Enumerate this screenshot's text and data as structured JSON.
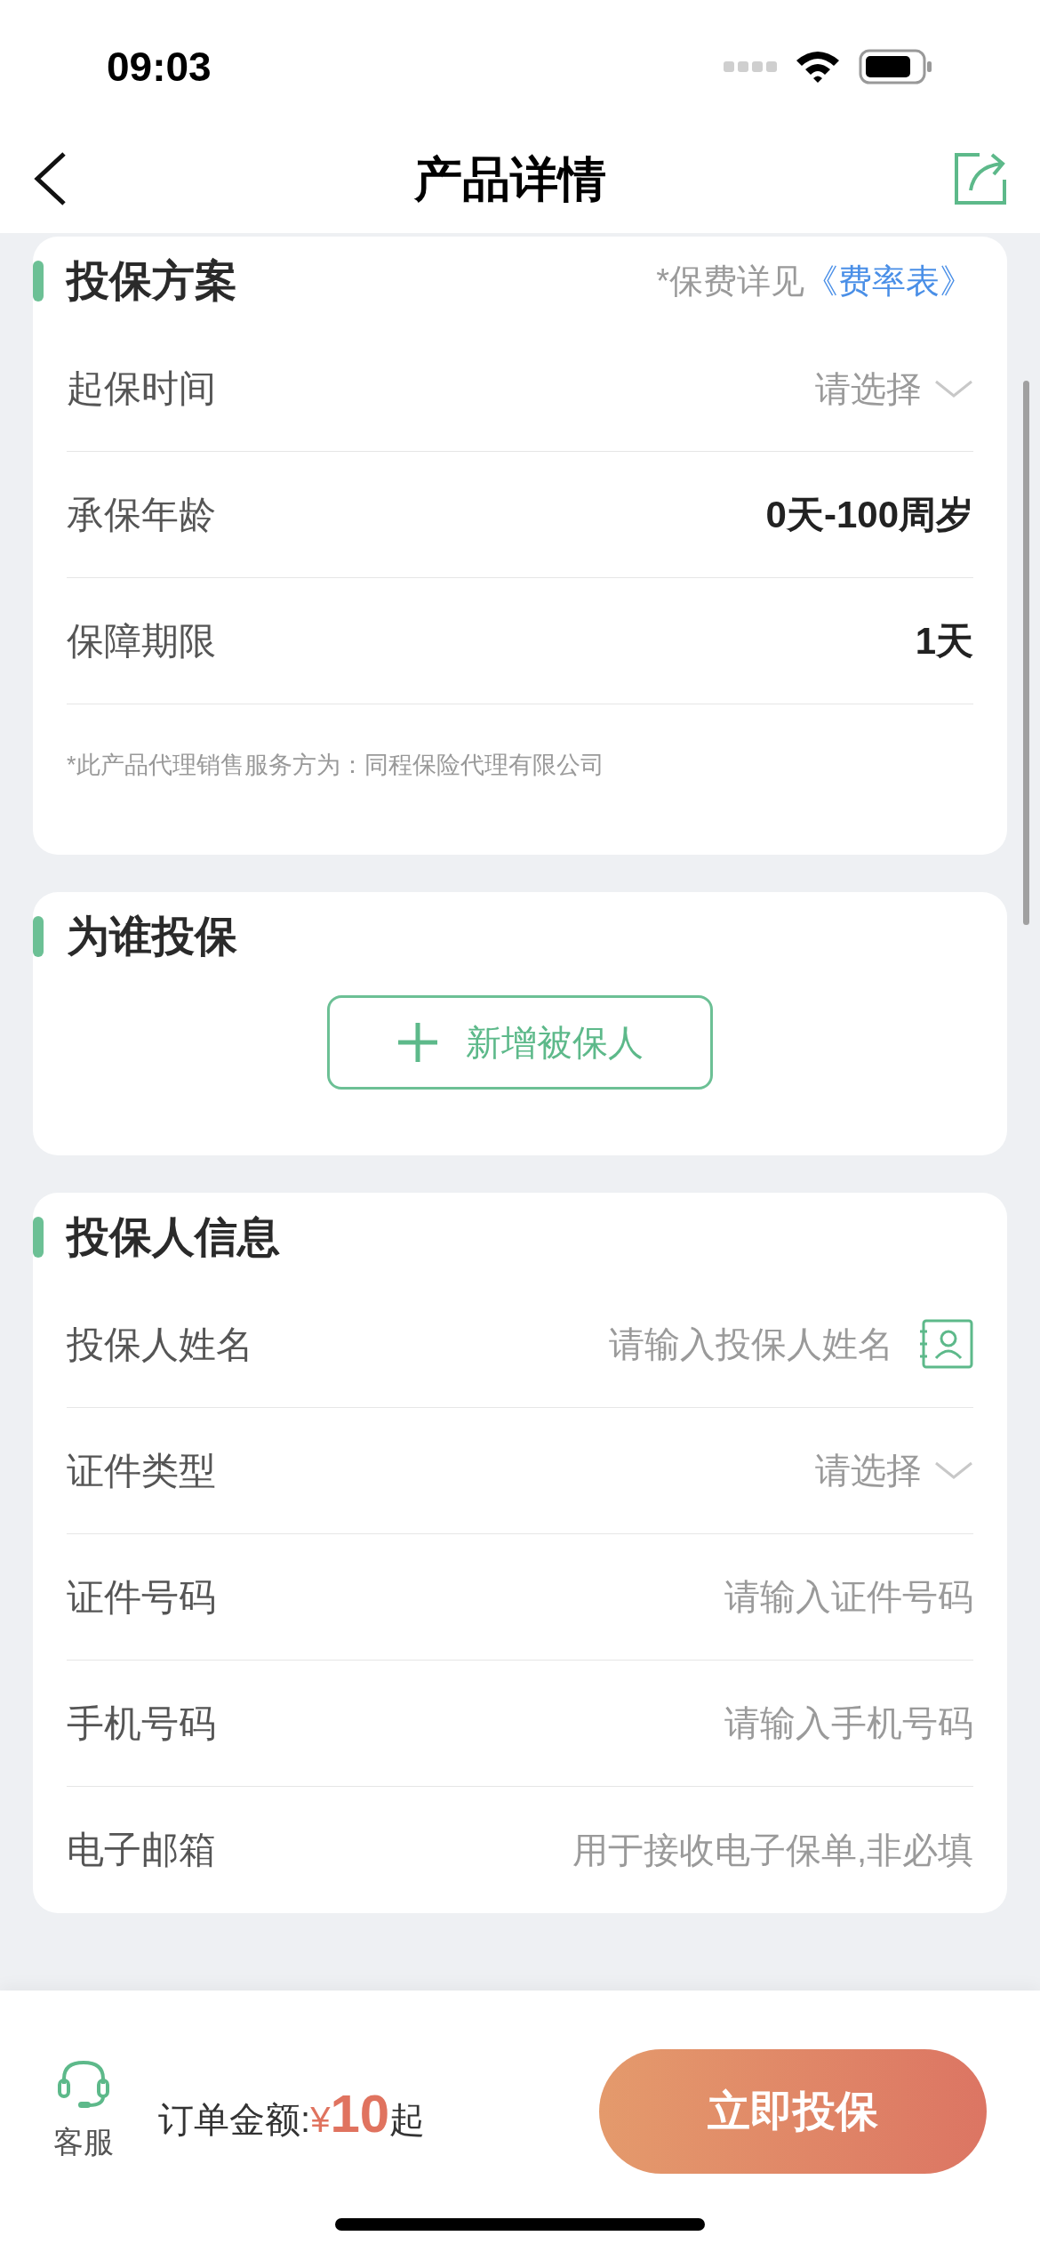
{
  "status_bar": {
    "time": "09:03"
  },
  "nav": {
    "title": "产品详情"
  },
  "plan": {
    "title": "投保方案",
    "note": "*保费详见",
    "note_link": "《费率表》",
    "rows": [
      {
        "kind": "select",
        "label": "起保时间",
        "placeholder": "请选择"
      },
      {
        "kind": "value",
        "label": "承保年龄",
        "value": "0天-100周岁"
      },
      {
        "kind": "value",
        "label": "保障期限",
        "value": "1天"
      }
    ],
    "footnote": "*此产品代理销售服务方为：同程保险代理有限公司"
  },
  "insured": {
    "title": "为谁投保",
    "add_button": "新增被保人"
  },
  "applicant": {
    "title": "投保人信息",
    "rows": [
      {
        "kind": "contact",
        "label": "投保人姓名",
        "placeholder": "请输入投保人姓名"
      },
      {
        "kind": "select",
        "label": "证件类型",
        "placeholder": "请选择"
      },
      {
        "kind": "input",
        "label": "证件号码",
        "placeholder": "请输入证件号码"
      },
      {
        "kind": "input",
        "label": "手机号码",
        "placeholder": "请输入手机号码"
      },
      {
        "kind": "input",
        "label": "电子邮箱",
        "placeholder": "用于接收电子保单,非必填"
      }
    ]
  },
  "bottom_bar": {
    "service": "客服",
    "amount_label": "订单金额:",
    "currency": "¥",
    "amount": "10",
    "amount_suffix": "起",
    "submit": "立即投保"
  }
}
